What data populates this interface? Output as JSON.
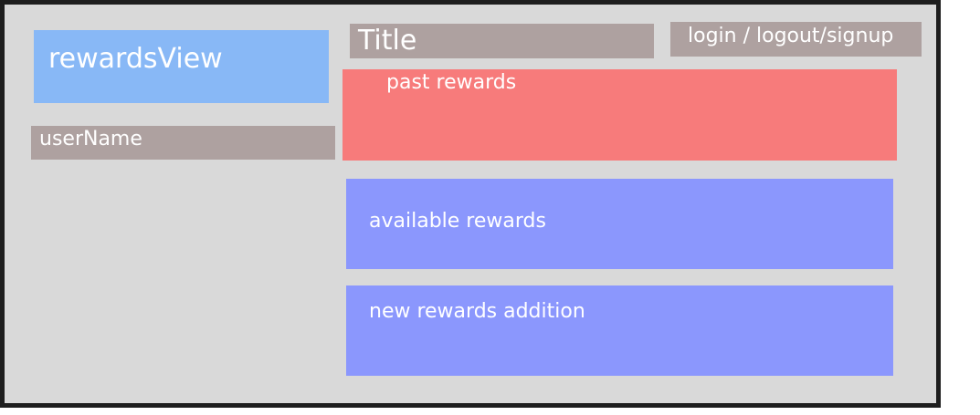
{
  "wireframe": {
    "rewards_view": "rewardsView",
    "user_name": "userName",
    "title": "Title",
    "auth": "login / logout/signup",
    "past_rewards": "past rewards",
    "available_rewards": "available rewards",
    "new_rewards_addition": "new rewards addition"
  },
  "colors": {
    "background": "#d9d9d9",
    "frame_border": "#1e1e1e",
    "view_block": "#88b8f6",
    "label_block": "#aea1a0",
    "past_rewards_block": "#f77b7b",
    "rewards_block": "#8b97fd",
    "text": "#ffffff"
  }
}
